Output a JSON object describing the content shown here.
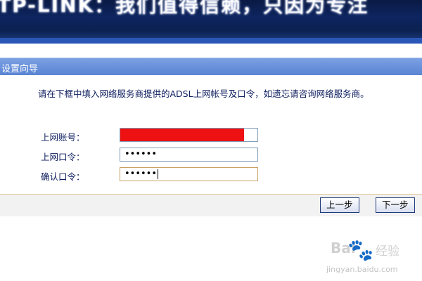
{
  "banner": {
    "title": "TP-LINK：我们值得信赖，只因为专注"
  },
  "panel": {
    "title": "设置向导"
  },
  "description": "请在下框中填入网络服务商提供的ADSL上网帐号及口令，如遗忘请咨询网络服务商。",
  "form": {
    "account_label": "上网账号：",
    "password_label": "上网口令：",
    "password_value": "••••••",
    "confirm_label": "确认口令：",
    "confirm_value": "••••••"
  },
  "buttons": {
    "prev": "上一步",
    "next": "下一步"
  },
  "watermark": {
    "brand": "Bai",
    "paw": "🐾",
    "jingyan": "经验",
    "url": "jingyan.baidu.com"
  },
  "colors": {
    "banner": "#0d2560",
    "header": "#5a84d3",
    "redact": "#ee1111",
    "text": "#102060"
  }
}
